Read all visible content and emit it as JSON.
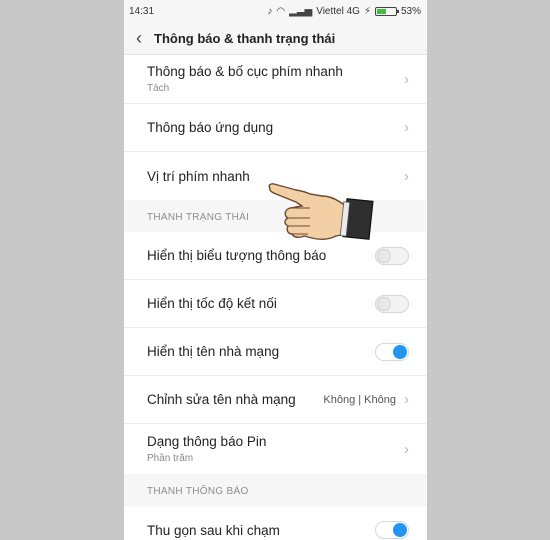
{
  "status": {
    "time": "14:31",
    "carrier": "Viettel 4G",
    "battery": "53%",
    "battery_level": 0.53
  },
  "header": {
    "title": "Thông báo & thanh trạng thái",
    "back_icon": "back-arrow-icon"
  },
  "group1": {
    "items": [
      {
        "label": "Thông báo & bố cục phím nhanh",
        "sub": "Tách"
      },
      {
        "label": "Thông báo ứng dụng"
      },
      {
        "label": "Vị trí phím nhanh"
      }
    ]
  },
  "group2": {
    "header": "THANH TRẠNG THÁI",
    "items": [
      {
        "label": "Hiển thị biểu tượng thông báo",
        "toggle": false
      },
      {
        "label": "Hiển thị tốc độ kết nối",
        "toggle": false
      },
      {
        "label": "Hiển thị tên nhà mạng",
        "toggle": true
      },
      {
        "label": "Chỉnh sửa tên nhà mạng",
        "value": "Không | Không"
      },
      {
        "label": "Dạng thông báo Pin",
        "sub": "Phần trăm"
      }
    ]
  },
  "group3": {
    "header": "THANH THÔNG BÁO",
    "items": [
      {
        "label": "Thu gọn sau khi chạm",
        "toggle": true
      }
    ]
  },
  "colors": {
    "accent": "#2196f3",
    "battery": "#3fbf3f"
  }
}
